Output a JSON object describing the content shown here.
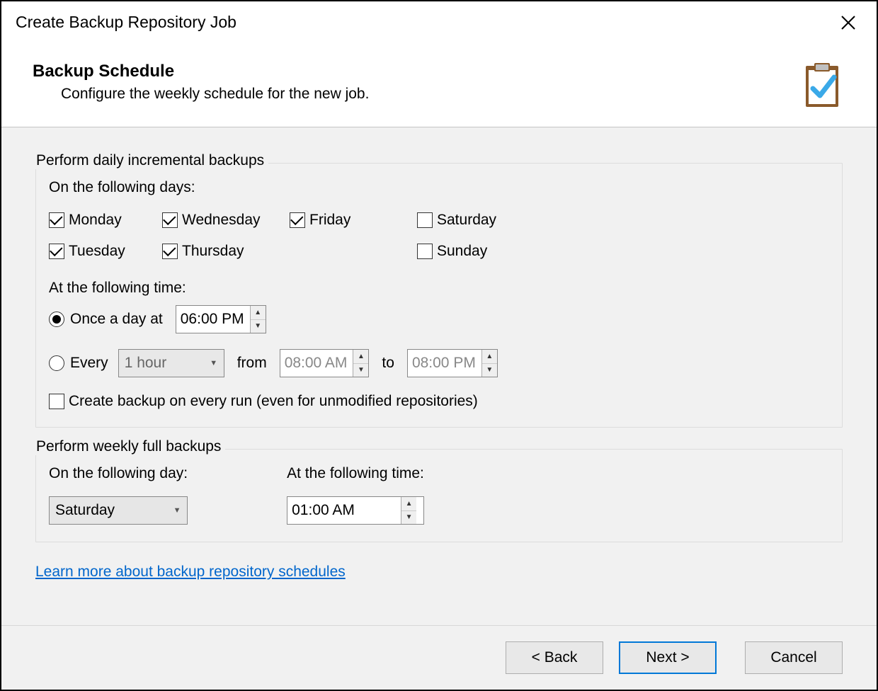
{
  "window": {
    "title": "Create Backup Repository Job"
  },
  "header": {
    "heading": "Backup Schedule",
    "subtitle": "Configure the weekly schedule for the new job."
  },
  "incremental": {
    "legend": "Perform daily incremental backups",
    "days_label": "On the following days:",
    "days": [
      {
        "label": "Monday",
        "checked": true
      },
      {
        "label": "Wednesday",
        "checked": true
      },
      {
        "label": "Friday",
        "checked": true
      },
      {
        "label": "Saturday",
        "checked": false
      },
      {
        "label": "Tuesday",
        "checked": true
      },
      {
        "label": "Thursday",
        "checked": true
      },
      {
        "label": "",
        "checked": false,
        "empty": true
      },
      {
        "label": "Sunday",
        "checked": false
      }
    ],
    "time_label": "At the following time:",
    "once": {
      "label": "Once a day at",
      "time": "06:00 PM",
      "selected": true
    },
    "every": {
      "label": "Every",
      "interval": "1 hour",
      "from_label": "from",
      "from_time": "08:00 AM",
      "to_label": "to",
      "to_time": "08:00 PM",
      "selected": false
    },
    "force": {
      "label": "Create backup on every run (even for unmodified repositories)",
      "checked": false
    }
  },
  "full": {
    "legend": "Perform weekly full backups",
    "day_label": "On the following day:",
    "day_value": "Saturday",
    "time_label": "At the following time:",
    "time_value": "01:00 AM"
  },
  "help_link": "Learn more about backup repository schedules",
  "footer": {
    "back": "< Back",
    "next": "Next >",
    "cancel": "Cancel"
  }
}
